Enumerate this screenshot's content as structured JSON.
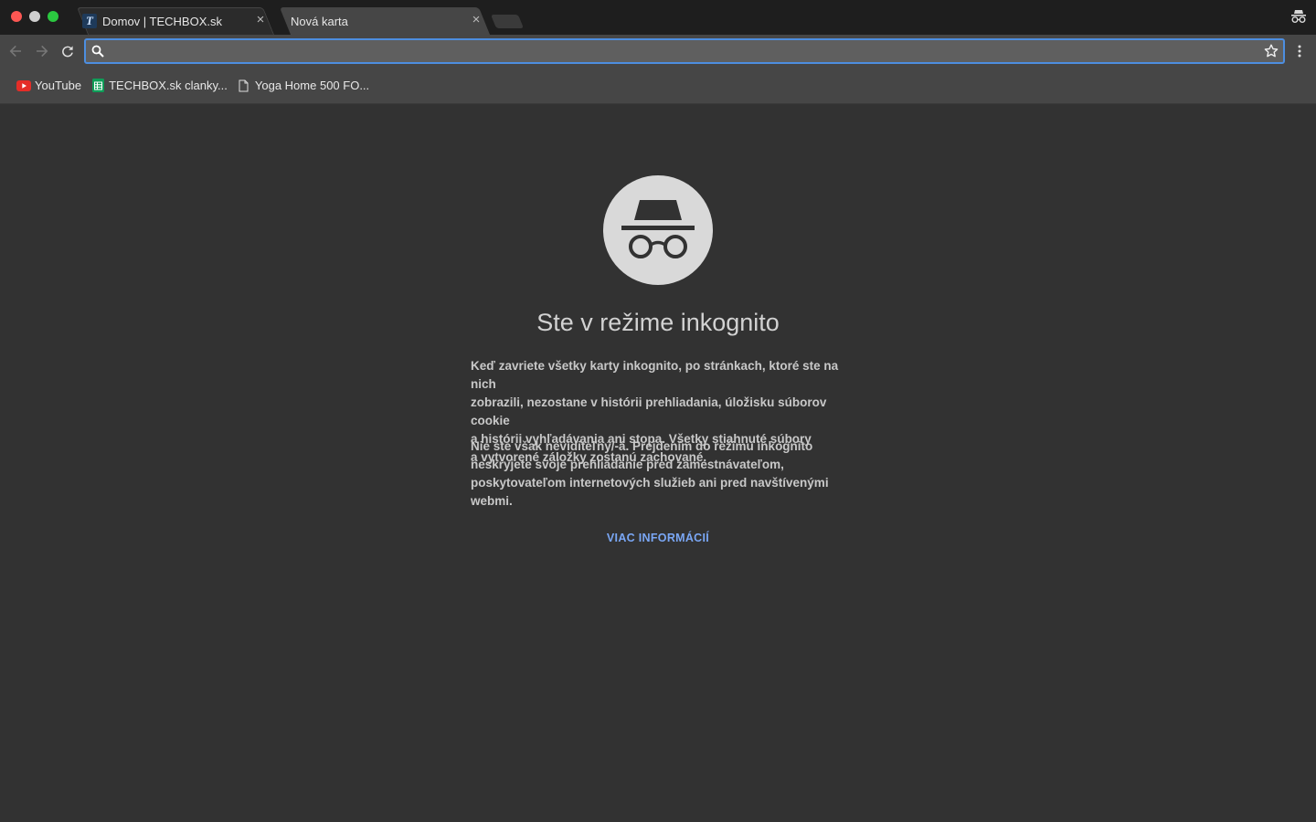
{
  "tabs": [
    {
      "title": "Domov | TECHBOX.sk",
      "favicon": "T",
      "active": false
    },
    {
      "title": "Nová karta",
      "active": true
    }
  ],
  "tab_close_glyph": "×",
  "omnibox": {
    "value": "",
    "placeholder": ""
  },
  "bookmarks": [
    {
      "label": "YouTube",
      "icon": "youtube-icon"
    },
    {
      "label": "TECHBOX.sk clanky...",
      "icon": "sheets-icon"
    },
    {
      "label": "Yoga Home 500 FO...",
      "icon": "page-icon"
    }
  ],
  "incognito": {
    "title": "Ste v režime inkognito",
    "paragraph1_lines": [
      "Keď zavriete všetky karty inkognito, po stránkach, ktoré ste na nich",
      "zobrazili, nezostane v histórii prehliadania, úložisku súborov cookie",
      "a histórii vyhľadávania ani stopa. Všetky stiahnuté súbory",
      "a vytvorené záložky zostanú zachované."
    ],
    "paragraph2_lines": [
      "Nie ste však neviditeľný/-á. Prejdením do režimu inkognito",
      "neskryjete svoje prehliadanie pred zamestnávateľom,",
      "poskytovateľom internetových služieb ani pred navštívenými webmi."
    ],
    "learn_more": "VIAC INFORMÁCIÍ"
  },
  "colors": {
    "accent": "#4d8ee0",
    "link": "#7aa7f5",
    "background": "#323232",
    "toolbar": "#464646",
    "youtube_red": "#e52d27",
    "sheets_green": "#0f9d58"
  }
}
